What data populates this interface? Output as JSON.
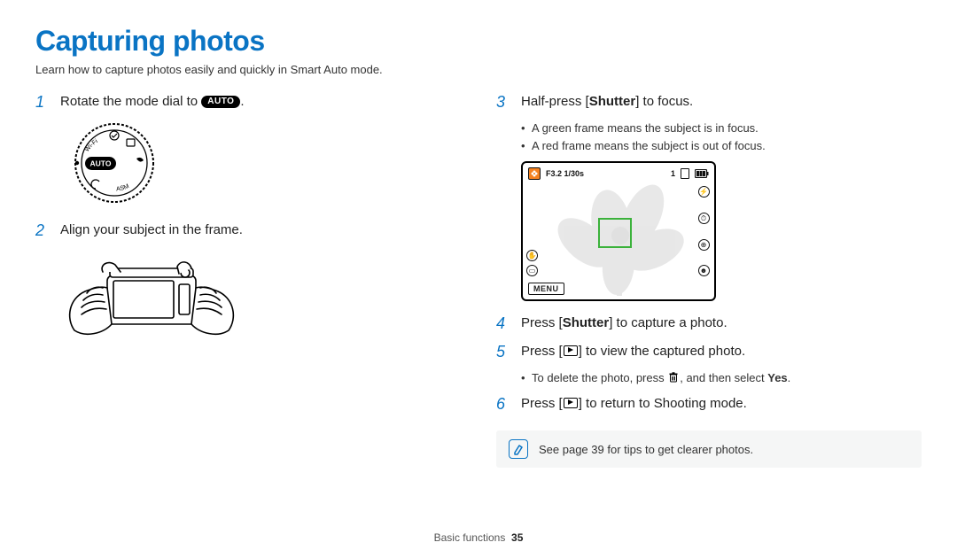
{
  "title": "Capturing photos",
  "intro": "Learn how to capture photos easily and quickly in Smart Auto mode.",
  "auto_label": "AUTO",
  "steps": {
    "s1_pre": "Rotate the mode dial to ",
    "s1_post": ".",
    "s2": "Align your subject in the frame.",
    "s3_a": "Half-press [",
    "s3_b": "Shutter",
    "s3_c": "] to focus.",
    "s3_bullets": [
      "A green frame means the subject is in focus.",
      "A red frame means the subject is out of focus."
    ],
    "s4_a": "Press [",
    "s4_b": "Shutter",
    "s4_c": "] to capture a photo.",
    "s5_a": "Press [",
    "s5_b": "] to view the captured photo.",
    "s5_bullet_a": "To delete the photo, press ",
    "s5_bullet_b": ", and then select ",
    "s5_bullet_c": "Yes",
    "s5_bullet_d": ".",
    "s6_a": "Press [",
    "s6_b": "] to return to Shooting mode."
  },
  "note": "See page 39 for tips to get clearer photos.",
  "lcd": {
    "exposure": "F3.2 1/30s",
    "count": "1",
    "menu": "MENU"
  },
  "footer_section": "Basic functions",
  "footer_page": "35",
  "dial_labels": {
    "wifi": "Wi-Fi",
    "asm": "ASM"
  }
}
